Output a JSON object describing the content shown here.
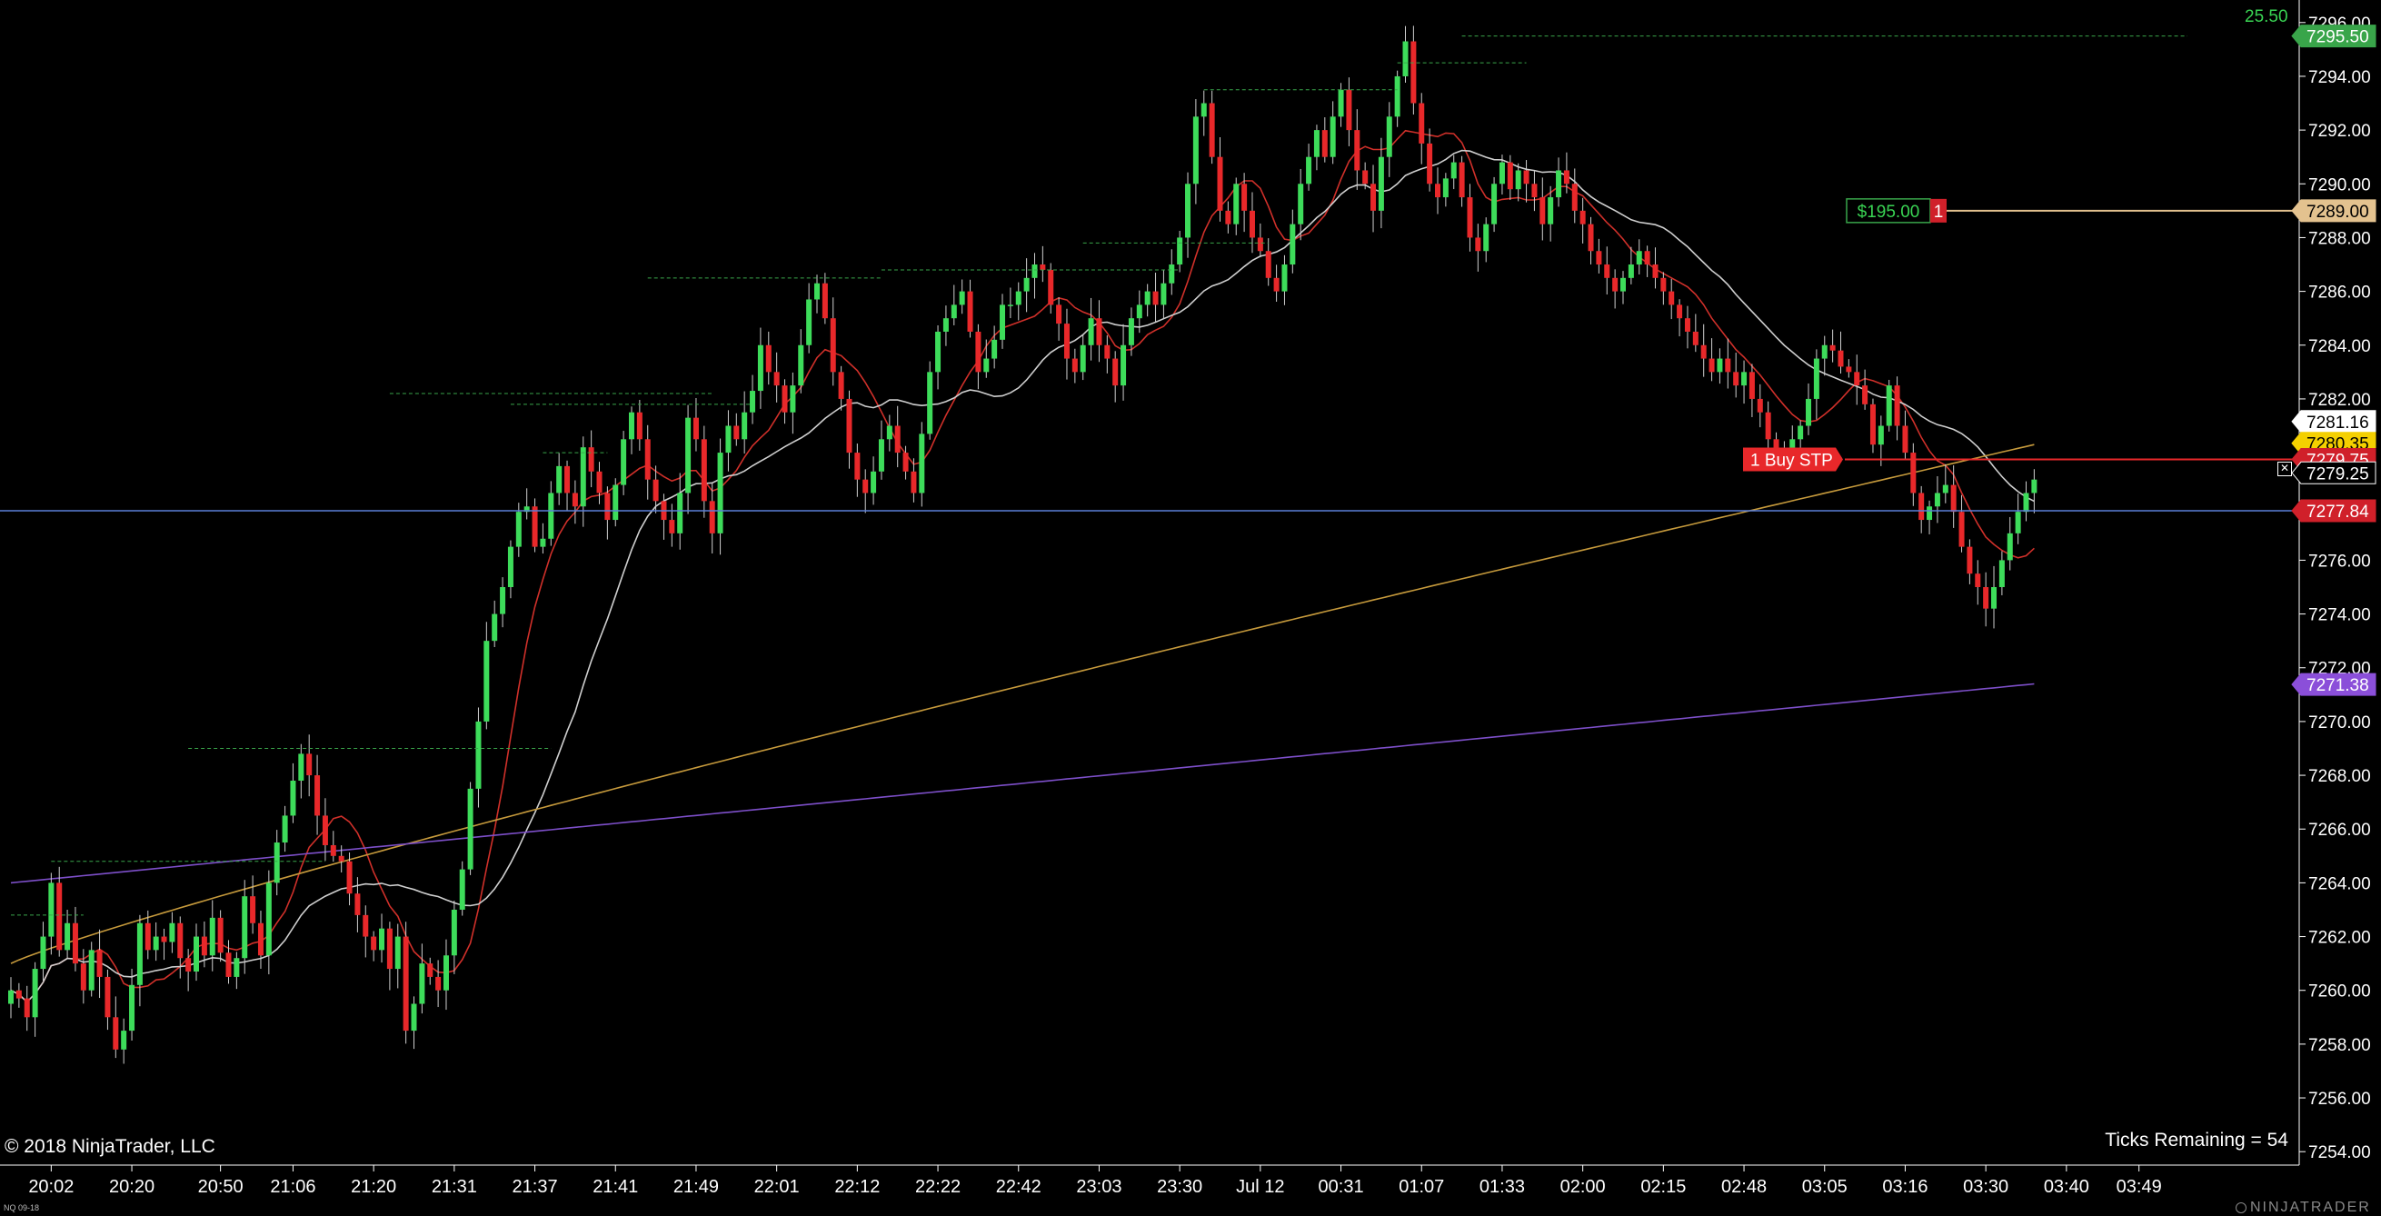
{
  "chart_data": {
    "type": "candlestick",
    "instrument": "NQ 09-18",
    "y_axis": {
      "range": [
        7253.5,
        7296.5
      ],
      "ticks": [
        7254,
        7256,
        7258,
        7260,
        7262,
        7264,
        7266,
        7268,
        7270,
        7272,
        7274,
        7276,
        7278,
        7280,
        7282,
        7284,
        7286,
        7288,
        7290,
        7292,
        7294,
        7296
      ],
      "tick_labels": [
        "7254.00",
        "7256.00",
        "7258.00",
        "7260.00",
        "7262.00",
        "7264.00",
        "7266.00",
        "7268.00",
        "7270.00",
        "7272.00",
        "7274.00",
        "7276.00",
        "7278.00",
        "7280.00",
        "7282.00",
        "7284.00",
        "7286.00",
        "7288.00",
        "7290.00",
        "7292.00",
        "7294.00",
        "7296.00"
      ]
    },
    "x_axis": {
      "tick_labels": [
        "20:02",
        "20:20",
        "20:50",
        "21:06",
        "21:20",
        "21:31",
        "21:37",
        "21:41",
        "21:49",
        "22:01",
        "22:12",
        "22:22",
        "22:42",
        "23:03",
        "23:30",
        "Jul 12",
        "00:31",
        "01:07",
        "01:33",
        "02:00",
        "02:15",
        "02:48",
        "03:05",
        "03:16",
        "03:30",
        "03:40",
        "03:49"
      ],
      "tick_bar_index": [
        5,
        15,
        26,
        35,
        45,
        55,
        65,
        75,
        85,
        95,
        105,
        115,
        125,
        135,
        145,
        155,
        165,
        175,
        185,
        195,
        205,
        215,
        225,
        235,
        245,
        255,
        264
      ]
    },
    "closes": [
      7260.0,
      7259.7,
      7259.0,
      7260.8,
      7262.0,
      7264.0,
      7261.5,
      7262.5,
      7261.0,
      7260.0,
      7261.5,
      7260.5,
      7259.0,
      7257.8,
      7258.5,
      7260.2,
      7262.5,
      7261.5,
      7262.0,
      7261.8,
      7262.5,
      7261.2,
      7260.7,
      7262.0,
      7261.3,
      7262.7,
      7261.4,
      7260.5,
      7261.2,
      7263.5,
      7262.5,
      7261.3,
      7264.0,
      7265.5,
      7266.5,
      7267.8,
      7268.8,
      7268.0,
      7266.5,
      7265.4,
      7265.0,
      7264.8,
      7263.6,
      7262.8,
      7262.0,
      7261.5,
      7262.3,
      7260.8,
      7262.0,
      7258.5,
      7259.5,
      7261.0,
      7260.5,
      7260.0,
      7261.3,
      7263.0,
      7264.5,
      7267.5,
      7270.0,
      7273.0,
      7274.0,
      7275.0,
      7276.5,
      7277.8,
      7278.0,
      7276.5,
      7276.8,
      7278.5,
      7279.5,
      7278.5,
      7278.0,
      7280.2,
      7279.3,
      7278.5,
      7277.5,
      7278.8,
      7280.5,
      7281.5,
      7280.5,
      7279.0,
      7278.2,
      7277.5,
      7277.0,
      7278.5,
      7281.3,
      7280.5,
      7278.2,
      7277.0,
      7280.0,
      7281.0,
      7280.5,
      7281.5,
      7282.3,
      7284.0,
      7283.0,
      7282.5,
      7281.5,
      7282.5,
      7284.0,
      7285.7,
      7286.3,
      7285.0,
      7283.0,
      7282.0,
      7280.0,
      7279.0,
      7278.5,
      7279.3,
      7280.5,
      7281.0,
      7280.0,
      7279.3,
      7278.5,
      7280.7,
      7283.0,
      7284.5,
      7285.0,
      7285.5,
      7286.0,
      7284.5,
      7283.0,
      7283.5,
      7284.2,
      7285.5,
      7285.5,
      7286.0,
      7286.5,
      7287.0,
      7286.8,
      7285.5,
      7284.8,
      7283.5,
      7283.0,
      7284.0,
      7285.0,
      7284.0,
      7283.5,
      7282.5,
      7284.0,
      7285.0,
      7285.5,
      7286.0,
      7285.5,
      7286.3,
      7287.0,
      7288.0,
      7290.0,
      7292.5,
      7293.0,
      7291.0,
      7289.0,
      7288.5,
      7290.0,
      7289.0,
      7288.0,
      7287.5,
      7286.5,
      7286.0,
      7287.0,
      7288.5,
      7290.0,
      7291.0,
      7292.0,
      7291.0,
      7292.5,
      7293.5,
      7292.0,
      7290.5,
      7290.0,
      7289.0,
      7291.0,
      7292.5,
      7294.0,
      7295.3,
      7293.0,
      7291.5,
      7290.0,
      7289.5,
      7290.2,
      7290.8,
      7289.5,
      7288.0,
      7287.5,
      7288.5,
      7290.0,
      7290.8,
      7289.8,
      7290.5,
      7290.0,
      7289.5,
      7288.5,
      7289.5,
      7290.5,
      7290.0,
      7289.0,
      7288.5,
      7287.5,
      7287.0,
      7286.5,
      7286.0,
      7286.5,
      7287.0,
      7287.5,
      7287.0,
      7286.5,
      7286.0,
      7285.5,
      7285.0,
      7284.5,
      7284.0,
      7283.5,
      7283.0,
      7283.5,
      7283.0,
      7282.5,
      7283.0,
      7282.0,
      7281.5,
      7280.5,
      7280.0,
      7279.8,
      7280.5,
      7281.0,
      7282.0,
      7283.5,
      7284.0,
      7283.8,
      7283.2,
      7283.0,
      7282.5,
      7281.8,
      7280.3,
      7281.0,
      7282.5,
      7281.0,
      7280.0,
      7278.5,
      7277.5,
      7278.0,
      7278.5,
      7278.8,
      7277.8,
      7276.5,
      7275.5,
      7275.0,
      7274.2,
      7275.0,
      7276.0,
      7277.0,
      7277.8,
      7278.5,
      7279.0
    ],
    "ema_fast": {
      "color": "#d0302a",
      "values": [
        7256.8,
        7257.4,
        7258.0,
        7258.8,
        7259.6,
        7260.5,
        7261.2,
        7262.5,
        7263.6,
        7264.3,
        7263.8,
        7262.6,
        7261.6,
        7261.0,
        7261.8,
        7263.6,
        7266.5,
        7270.3,
        7273.6,
        7275.5,
        7276.3,
        7276.9,
        7277.6,
        7278.6,
        7279.8,
        7281.0,
        7281.5,
        7282.0,
        7282.6,
        7283.3,
        7284.2,
        7284.6,
        7285.0,
        7285.4,
        7286.0,
        7286.8,
        7288.8,
        7289.7,
        7290.0,
        7290.3,
        7290.7,
        7290.5,
        7289.8,
        7289.6,
        7289.2,
        7288.5,
        7287.6,
        7286.6,
        7285.5,
        7284.7,
        7283.7,
        7283.0,
        7282.2,
        7281.3,
        7280.3,
        7279.4,
        7278.6,
        7278.0
      ],
      "bars": [
        0,
        10,
        20,
        30,
        40,
        50,
        60,
        70,
        80,
        90,
        100,
        110,
        120,
        130,
        140,
        150,
        160,
        170,
        180,
        190,
        200,
        210,
        220,
        230,
        240,
        250,
        260,
        270,
        280,
        290,
        300,
        310,
        320,
        330,
        340,
        350,
        360,
        370,
        380,
        390,
        400,
        410,
        420,
        430,
        440,
        450,
        460,
        470,
        480,
        490,
        500,
        510,
        520,
        530,
        540,
        550,
        560,
        570
      ]
    },
    "sma_white": {
      "color": "#cfcfcf"
    },
    "sma_orange": {
      "color": "#c69a3c"
    },
    "sma_purple": {
      "color": "#7d4fc9"
    },
    "price_labels": [
      {
        "text": "7295.50",
        "price": 7295.5,
        "bg": "#39a54a",
        "fg": "#ffffff"
      },
      {
        "text": "7289.00",
        "price": 7289.0,
        "bg": "#e3c28f",
        "fg": "#000000"
      },
      {
        "text": "7281.16",
        "price": 7281.16,
        "bg": "#ffffff",
        "fg": "#000000"
      },
      {
        "text": "7280.35",
        "price": 7280.35,
        "bg": "#f4d000",
        "fg": "#000000"
      },
      {
        "text": "7279.75",
        "price": 7279.75,
        "bg": "#d0202a",
        "fg": "#ffffff"
      },
      {
        "text": "7279.25",
        "price": 7279.25,
        "bg": "#000000",
        "fg": "#ffffff"
      },
      {
        "text": "7277.84",
        "price": 7277.84,
        "bg": "#d0202a",
        "fg": "#ffffff"
      },
      {
        "text": "7271.38",
        "price": 7271.38,
        "bg": "#8b4fd9",
        "fg": "#ffffff"
      }
    ],
    "last_price_line": {
      "price": 7277.84,
      "color": "#5b7fd8"
    },
    "position": {
      "pnl": "$195.00",
      "qty": "1",
      "entry_price": 7289.0
    },
    "order": {
      "label": "1 Buy STP",
      "price": 7279.75
    }
  },
  "texts": {
    "copyright": "© 2018 NinjaTrader, LLC",
    "ticks_remaining": "Ticks Remaining = 54",
    "top_value": "25.50",
    "contract": "NQ 09-18",
    "brand": "NINJATRADER",
    "close_order": "✕"
  }
}
